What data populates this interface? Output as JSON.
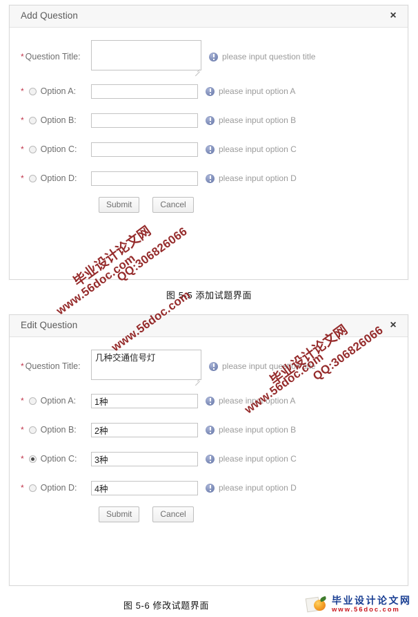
{
  "colors": {
    "required_star": "#c0344a",
    "hint_text": "#9a9a9a",
    "header_bg": "#f7f7f7",
    "watermark": "#8e1b1b",
    "logo_blue": "#1a3f93",
    "logo_red": "#c8161d"
  },
  "add_dialog": {
    "title": "Add Question",
    "close_label": "×",
    "question_title": {
      "label": "*Question Title:",
      "star": "*",
      "label_text": "Question Title:",
      "value": "",
      "hint": "please input question title"
    },
    "options": [
      {
        "star": "*",
        "label": "Option A:",
        "value": "",
        "hint": "please input option A",
        "checked": false
      },
      {
        "star": "*",
        "label": "Option B:",
        "value": "",
        "hint": "please input option B",
        "checked": false
      },
      {
        "star": "*",
        "label": "Option C:",
        "value": "",
        "hint": "please input option C",
        "checked": false
      },
      {
        "star": "*",
        "label": "Option D:",
        "value": "",
        "hint": "please input option D",
        "checked": false
      }
    ],
    "submit_label": "Submit",
    "cancel_label": "Cancel"
  },
  "edit_dialog": {
    "title": "Edit Question",
    "close_label": "×",
    "question_title": {
      "star": "*",
      "label_text": "Question Title:",
      "value": "几种交通信号灯",
      "hint": "please input question title"
    },
    "options": [
      {
        "star": "*",
        "label": "Option A:",
        "value": "1种",
        "hint": "please input option A",
        "checked": false
      },
      {
        "star": "*",
        "label": "Option B:",
        "value": "2种",
        "hint": "please input option B",
        "checked": false
      },
      {
        "star": "*",
        "label": "Option C:",
        "value": "3种",
        "hint": "please input option C",
        "checked": true
      },
      {
        "star": "*",
        "label": "Option D:",
        "value": "4种",
        "hint": "please input option D",
        "checked": false
      }
    ],
    "submit_label": "Submit",
    "cancel_label": "Cancel"
  },
  "captions": {
    "figure_5_5": "图 5-5  添加试题界面",
    "figure_5_6": "图 5-6  修改试题界面"
  },
  "site_logo": {
    "name_cn": "毕业设计论文网",
    "url": "www.56doc.com"
  },
  "watermark": {
    "name_cn": "毕业设计论文网",
    "qq": "QQ:306826066",
    "url": "www.56doc.com"
  }
}
